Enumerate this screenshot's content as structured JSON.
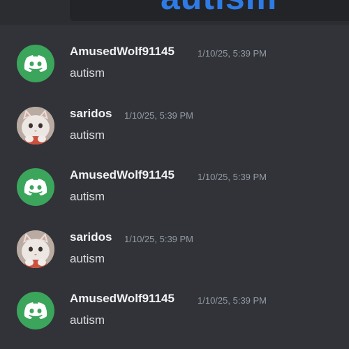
{
  "header": {
    "embed_text": "autism"
  },
  "messages": [
    {
      "author": "AmusedWolf91145",
      "avatar": "discord-logo-icon",
      "timestamp": "1/10/25, 5:39 PM",
      "content": "autism"
    },
    {
      "author": "saridos",
      "avatar": "cat-avatar-icon",
      "timestamp": "1/10/25, 5:39 PM",
      "content": "autism"
    },
    {
      "author": "AmusedWolf91145",
      "avatar": "discord-logo-icon",
      "timestamp": "1/10/25, 5:39 PM",
      "content": "autism"
    },
    {
      "author": "saridos",
      "avatar": "cat-avatar-icon",
      "timestamp": "1/10/25, 5:39 PM",
      "content": "autism"
    },
    {
      "author": "AmusedWolf91145",
      "avatar": "discord-logo-icon",
      "timestamp": "1/10/25, 5:39 PM",
      "content": "autism"
    }
  ],
  "colors": {
    "background": "#313338",
    "discord_avatar": "#3ba55c",
    "username": "#f2f3f5",
    "timestamp": "#949ba4",
    "message_text": "#dbdee1",
    "embed_accent": "#2e7be5"
  }
}
